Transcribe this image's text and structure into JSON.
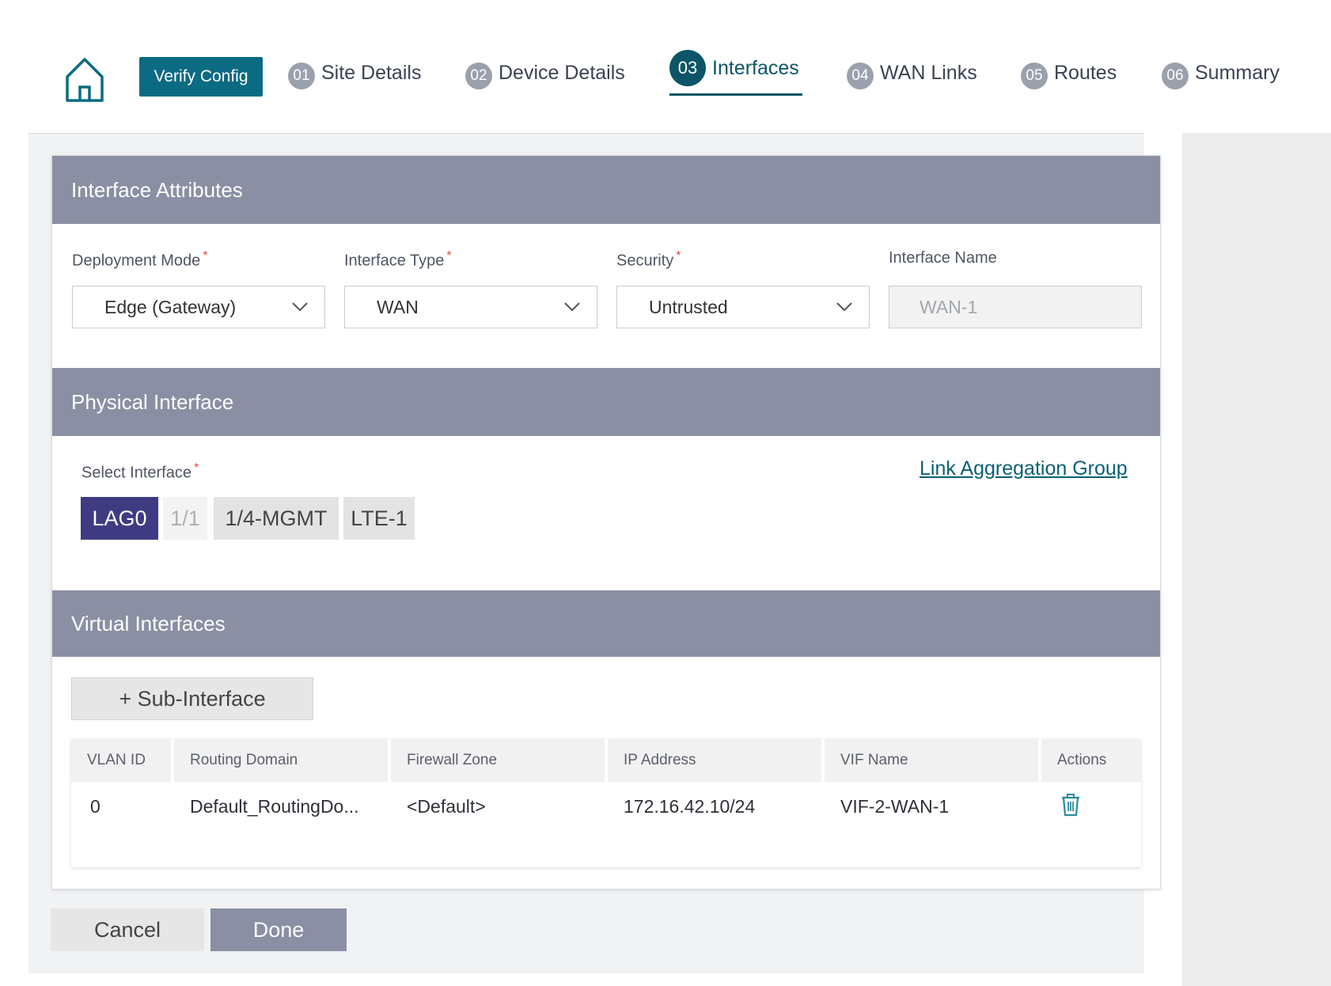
{
  "wizard": {
    "verify_label": "Verify Config",
    "steps": [
      {
        "num": "01",
        "label": "Site Details"
      },
      {
        "num": "02",
        "label": "Device Details"
      },
      {
        "num": "03",
        "label": "Interfaces"
      },
      {
        "num": "04",
        "label": "WAN Links"
      },
      {
        "num": "05",
        "label": "Routes"
      },
      {
        "num": "06",
        "label": "Summary"
      }
    ],
    "active_step": "03",
    "accent_color": "#0b5566",
    "button_color": "#0b6b83"
  },
  "attributes": {
    "title": "Interface Attributes",
    "deployment_mode": {
      "label": "Deployment Mode",
      "value": "Edge (Gateway)",
      "required": "*"
    },
    "interface_type": {
      "label": "Interface Type",
      "value": "WAN",
      "required": "*"
    },
    "security": {
      "label": "Security",
      "value": "Untrusted",
      "required": "*"
    },
    "interface_name": {
      "label": "Interface Name",
      "value": "WAN-1"
    }
  },
  "physical": {
    "title": "Physical Interface",
    "select_label": "Select Interface",
    "required": "*",
    "lag_link": "Link Aggregation Group",
    "interfaces": [
      {
        "label": "LAG0",
        "state": "selected"
      },
      {
        "label": "1/1",
        "state": "disabled"
      },
      {
        "label": "1/4-MGMT",
        "state": "normal"
      },
      {
        "label": "LTE-1",
        "state": "normal"
      }
    ],
    "selected_color": "#3f3b82"
  },
  "virtual": {
    "title": "Virtual Interfaces",
    "add_label": "+ Sub-Interface",
    "columns": [
      "VLAN ID",
      "Routing Domain",
      "Firewall Zone",
      "IP Address",
      "VIF Name",
      "Actions"
    ],
    "rows": [
      {
        "vlan_id": "0",
        "routing_domain": "Default_RoutingDo...",
        "firewall_zone": "<Default>",
        "ip_address": "172.16.42.10/24",
        "vif_name": "VIF-2-WAN-1",
        "action_icon": "trash-icon"
      }
    ]
  },
  "footer": {
    "cancel_label": "Cancel",
    "done_label": "Done"
  },
  "colors": {
    "section_header": "#8a8fa3",
    "required_marker": "#e04b3b"
  }
}
